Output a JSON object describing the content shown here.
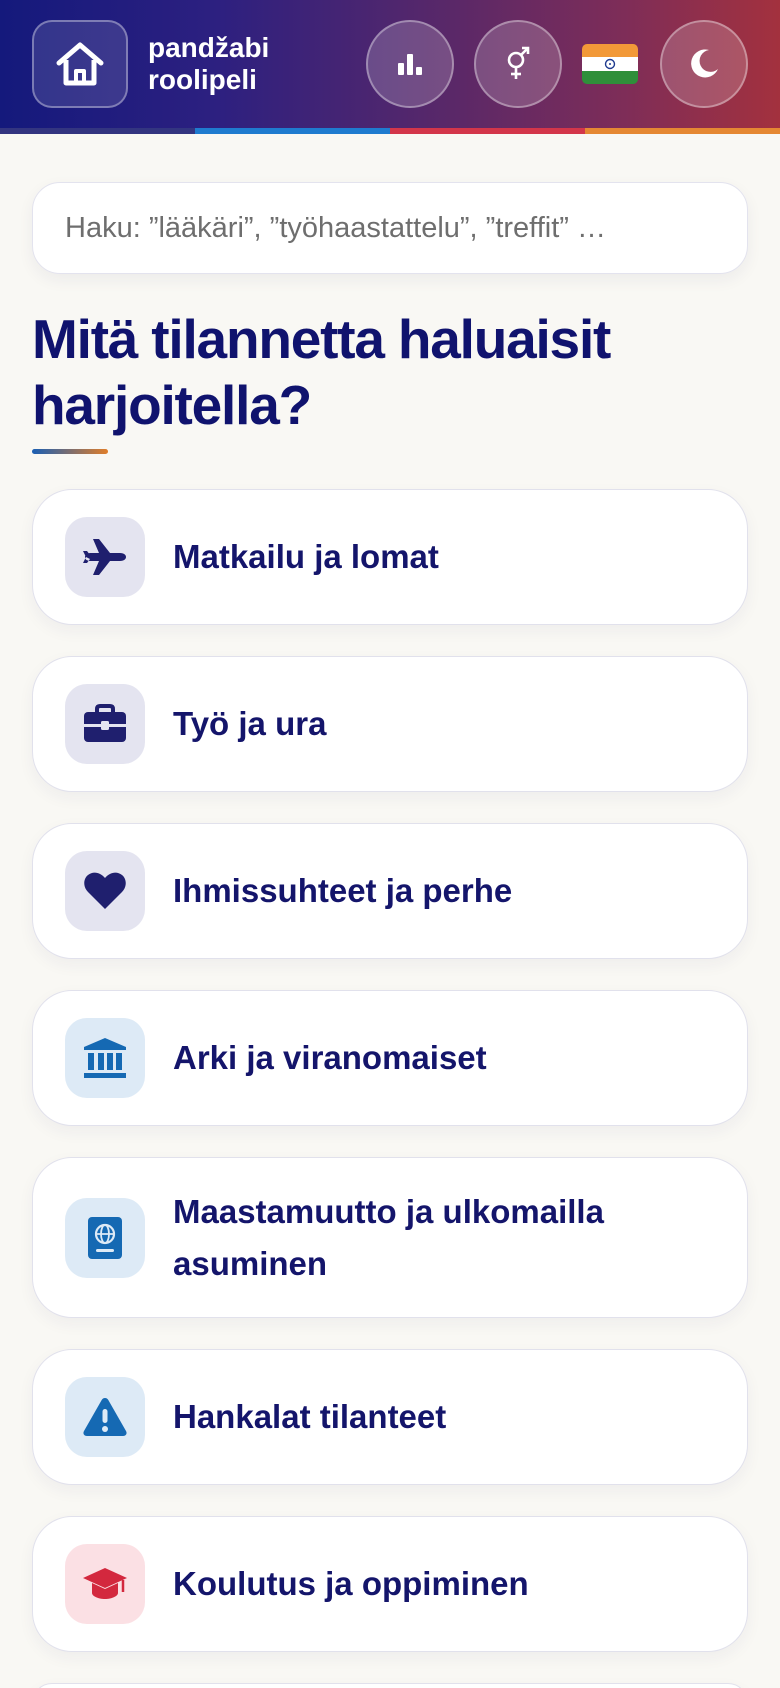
{
  "header": {
    "brand_line1": "pandžabi",
    "brand_line2": "roolipeli",
    "icons": [
      "home-icon",
      "stats-icon",
      "gender-icon",
      "india-flag-icon",
      "moon-icon"
    ],
    "stripe_colors": [
      "#333580",
      "#1f7bcf",
      "#d3364a",
      "#e58833"
    ]
  },
  "search": {
    "placeholder": "Haku: ”lääkäri”, ”työhaastattelu”, ”treffit” …"
  },
  "main": {
    "title": "Mitä tilannetta haluaisit harjoitella?",
    "categories": [
      {
        "label": "Matkailu ja lomat",
        "icon": "plane-icon",
        "icon_bg": "#e4e4f0",
        "icon_color": "#1f1f6e"
      },
      {
        "label": "Työ ja ura",
        "icon": "briefcase-icon",
        "icon_bg": "#e4e4f0",
        "icon_color": "#1f1f6e"
      },
      {
        "label": "Ihmissuhteet ja perhe",
        "icon": "heart-icon",
        "icon_bg": "#e4e4f0",
        "icon_color": "#1f1f6e"
      },
      {
        "label": "Arki ja viranomaiset",
        "icon": "building-columns-icon",
        "icon_bg": "#ddeaf6",
        "icon_color": "#1569b3"
      },
      {
        "label": "Maastamuutto ja ulkomailla asuminen",
        "icon": "passport-icon",
        "icon_bg": "#ddeaf6",
        "icon_color": "#1569b3"
      },
      {
        "label": "Hankalat tilanteet",
        "icon": "warning-icon",
        "icon_bg": "#ddeaf6",
        "icon_color": "#1569b3"
      },
      {
        "label": "Koulutus ja oppiminen",
        "icon": "graduation-cap-icon",
        "icon_bg": "#fbe0e4",
        "icon_color": "#d3283e"
      }
    ]
  }
}
